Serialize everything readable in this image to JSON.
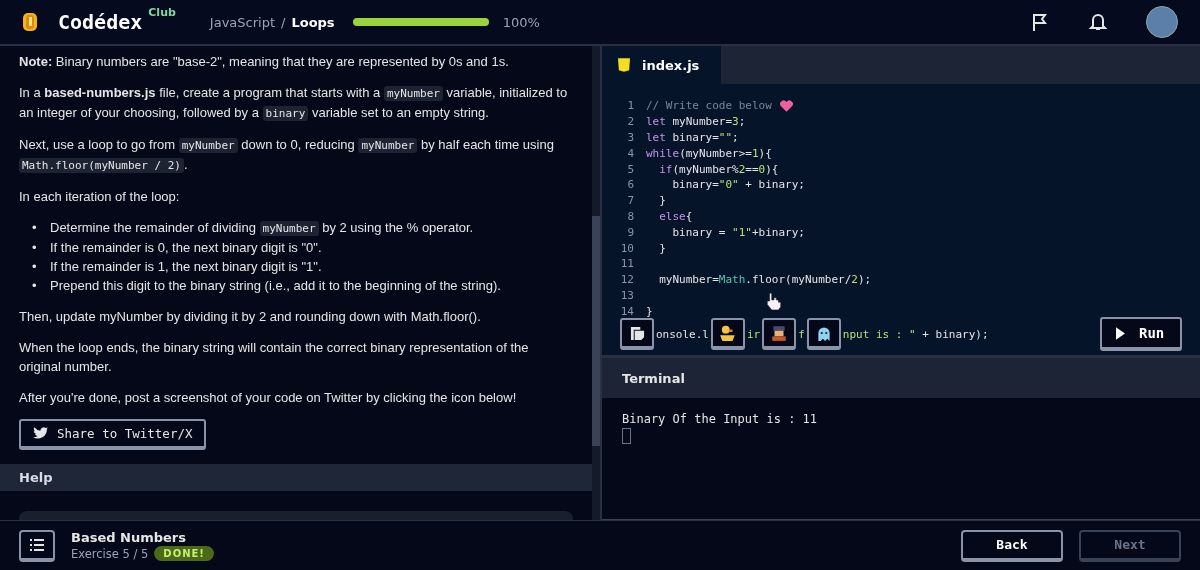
{
  "header": {
    "logo": "Codédex",
    "logo_badge": "Club",
    "breadcrumb": [
      {
        "label": "JavaScript",
        "current": false
      },
      {
        "label": "Loops",
        "current": true
      }
    ],
    "breadcrumb_separator": "/",
    "progress": {
      "level": 1.0,
      "reading": "100%"
    }
  },
  "instructions": {
    "paragraphs": [
      [
        {
          "kind": "bold",
          "text": "Note:"
        },
        {
          "kind": "text",
          "text": " Binary numbers are \"base-2\", meaning that they are represented by 0s and 1s."
        }
      ],
      [
        {
          "kind": "text",
          "text": "In a "
        },
        {
          "kind": "bold",
          "text": "based-numbers.js"
        },
        {
          "kind": "text",
          "text": " file, create a program that starts with a "
        },
        {
          "kind": "code",
          "text": "myNumber"
        },
        {
          "kind": "text",
          "text": " variable, initialized to an integer of your choosing, followed by a "
        },
        {
          "kind": "code",
          "text": "binary"
        },
        {
          "kind": "text",
          "text": " variable set to an empty string."
        }
      ],
      [
        {
          "kind": "text",
          "text": "Next, use a loop to go from "
        },
        {
          "kind": "code",
          "text": "myNumber"
        },
        {
          "kind": "text",
          "text": " down to 0, reducing "
        },
        {
          "kind": "code",
          "text": "myNumber"
        },
        {
          "kind": "text",
          "text": " by half each time using "
        },
        {
          "kind": "code",
          "text": "Math.floor(myNumber / 2)"
        },
        {
          "kind": "text",
          "text": "."
        }
      ],
      [
        {
          "kind": "text",
          "text": "In each iteration of the loop:"
        }
      ]
    ],
    "bullet_marker": "•",
    "bullets": [
      [
        {
          "kind": "text",
          "text": "Determine the remainder of dividing "
        },
        {
          "kind": "code",
          "text": "myNumber"
        },
        {
          "kind": "text",
          "text": " by 2 using the % operator."
        }
      ],
      [
        {
          "kind": "text",
          "text": "If the remainder is 0, the next binary digit is \"0\"."
        }
      ],
      [
        {
          "kind": "text",
          "text": "If the remainder is 1, the next binary digit is \"1\"."
        }
      ],
      [
        {
          "kind": "text",
          "text": "Prepend this digit to the binary string (i.e., add it to the beginning of the string)."
        }
      ]
    ],
    "after": [
      [
        {
          "kind": "text",
          "text": "Then, update myNumber by dividing it by 2 and rounding down with Math.floor()."
        }
      ],
      [
        {
          "kind": "text",
          "text": "When the loop ends, the binary string will contain the correct binary representation of the original number."
        }
      ],
      [
        {
          "kind": "text",
          "text": "After you're done, post a screenshot of your code on Twitter by clicking the icon below!"
        }
      ]
    ],
    "share_button": "Share to Twitter/X"
  },
  "help": {
    "title": "Help"
  },
  "editor": {
    "tabs": [
      {
        "label": "index.js",
        "selected": true
      }
    ],
    "lines": [
      {
        "number": "1",
        "tokens": [
          {
            "kind": "comment",
            "text": "// Write code below"
          }
        ]
      },
      {
        "number": "2",
        "tokens": [
          {
            "kind": "keyword",
            "text": "let"
          },
          {
            "kind": "plain",
            "text": " myNumber="
          },
          {
            "kind": "number",
            "text": "3"
          },
          {
            "kind": "plain",
            "text": ";"
          }
        ]
      },
      {
        "number": "3",
        "tokens": [
          {
            "kind": "keyword",
            "text": "let"
          },
          {
            "kind": "plain",
            "text": " binary="
          },
          {
            "kind": "string",
            "text": "\"\""
          },
          {
            "kind": "plain",
            "text": ";"
          }
        ]
      },
      {
        "number": "4",
        "tokens": [
          {
            "kind": "keyword",
            "text": "while"
          },
          {
            "kind": "plain",
            "text": "(myNumber>="
          },
          {
            "kind": "number",
            "text": "1"
          },
          {
            "kind": "plain",
            "text": "){"
          }
        ]
      },
      {
        "number": "5",
        "tokens": [
          {
            "kind": "keyword",
            "text": "  if"
          },
          {
            "kind": "plain",
            "text": "(myNumber%"
          },
          {
            "kind": "number",
            "text": "2"
          },
          {
            "kind": "plain",
            "text": "=="
          },
          {
            "kind": "number",
            "text": "0"
          },
          {
            "kind": "plain",
            "text": "){"
          }
        ]
      },
      {
        "number": "6",
        "tokens": [
          {
            "kind": "plain",
            "text": "    binary="
          },
          {
            "kind": "string",
            "text": "\"0\""
          },
          {
            "kind": "plain",
            "text": " + binary;"
          }
        ]
      },
      {
        "number": "7",
        "tokens": [
          {
            "kind": "plain",
            "text": "  }"
          }
        ]
      },
      {
        "number": "8",
        "tokens": [
          {
            "kind": "keyword",
            "text": "  else"
          },
          {
            "kind": "plain",
            "text": "{"
          }
        ]
      },
      {
        "number": "9",
        "tokens": [
          {
            "kind": "plain",
            "text": "    binary = "
          },
          {
            "kind": "string",
            "text": "\"1\""
          },
          {
            "kind": "plain",
            "text": "+binary;"
          }
        ]
      },
      {
        "number": "10",
        "tokens": [
          {
            "kind": "plain",
            "text": "  }"
          }
        ]
      },
      {
        "number": "11"
      },
      {
        "number": "12",
        "tokens": [
          {
            "kind": "plain",
            "text": "  myNumber="
          },
          {
            "kind": "class",
            "text": "Math"
          },
          {
            "kind": "plain",
            "text": ".floor(myNumber/"
          },
          {
            "kind": "number",
            "text": "2"
          },
          {
            "kind": "plain",
            "text": ");"
          }
        ]
      },
      {
        "number": "13"
      },
      {
        "number": "14",
        "tokens": [
          {
            "kind": "plain",
            "text": "}"
          }
        ]
      }
    ],
    "partial_line": [
      {
        "kind": "plain",
        "text": "onsole.l"
      },
      {
        "kind": "string",
        "text": "ir"
      },
      {
        "kind": "string",
        "text": "f"
      },
      {
        "kind": "string",
        "text": "nput is : \""
      },
      {
        "kind": "plain",
        "text": " + binary);"
      }
    ],
    "run_button": "Run"
  },
  "terminal": {
    "title": "Terminal",
    "output": "Binary Of the Input is : 11"
  },
  "footer": {
    "title": "Based Numbers",
    "exercise": "Exercise 5 / 5",
    "badge": "DONE!",
    "buttons": [
      {
        "label": "Back",
        "disabled": false
      },
      {
        "label": "Next",
        "disabled": true
      }
    ]
  }
}
